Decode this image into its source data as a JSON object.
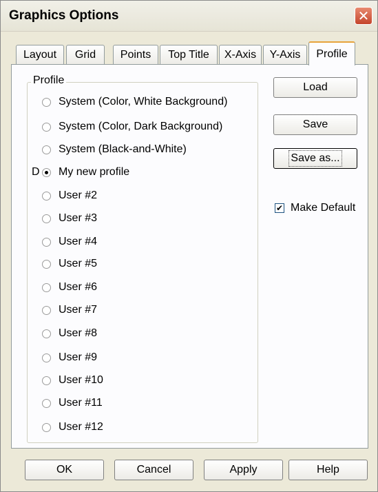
{
  "window": {
    "title": "Graphics Options",
    "close_glyph": "✕"
  },
  "tabs": [
    {
      "label": "Layout"
    },
    {
      "label": "Grid"
    },
    {
      "label": "Points"
    },
    {
      "label": "Top Title"
    },
    {
      "label": "X-Axis"
    },
    {
      "label": "Y-Axis"
    },
    {
      "label": "Profile",
      "active": true
    }
  ],
  "profile_group": {
    "legend": "Profile",
    "default_marker": "D",
    "options": [
      {
        "label": "System (Color, White Background)",
        "checked": false
      },
      {
        "label": "System (Color, Dark Background)",
        "checked": false
      },
      {
        "label": "System (Black-and-White)",
        "checked": false
      },
      {
        "label": "My new profile",
        "checked": true
      },
      {
        "label": "User #2",
        "checked": false
      },
      {
        "label": "User #3",
        "checked": false
      },
      {
        "label": "User #4",
        "checked": false
      },
      {
        "label": "User #5",
        "checked": false
      },
      {
        "label": "User #6",
        "checked": false
      },
      {
        "label": "User #7",
        "checked": false
      },
      {
        "label": "User #8",
        "checked": false
      },
      {
        "label": "User #9",
        "checked": false
      },
      {
        "label": "User #10",
        "checked": false
      },
      {
        "label": "User #11",
        "checked": false
      },
      {
        "label": "User #12",
        "checked": false
      }
    ]
  },
  "side_buttons": {
    "load": "Load",
    "save": "Save",
    "save_as": "Save as..."
  },
  "make_default": {
    "label": "Make Default",
    "checked": true,
    "check_glyph": "✔"
  },
  "footer_buttons": {
    "ok": "OK",
    "cancel": "Cancel",
    "apply": "Apply",
    "help": "Help"
  },
  "colors": {
    "accent_close": "#c4452c",
    "tab_highlight": "#e7a33a",
    "dialog_bg": "#ece9d8"
  }
}
